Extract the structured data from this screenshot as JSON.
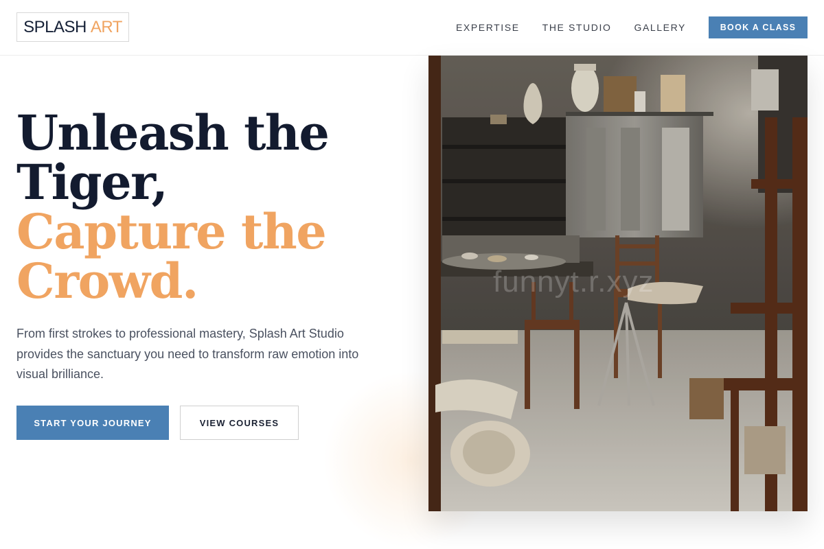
{
  "header": {
    "logo_brand": "SPLASH",
    "logo_accent": "ART",
    "nav": [
      "EXPERTISE",
      "THE STUDIO",
      "GALLERY"
    ],
    "cta_label": "BOOK A CLASS"
  },
  "hero": {
    "title_line1": "Unleash the",
    "title_line2": "Tiger,",
    "title_line3": "Capture the",
    "title_line4": "Crowd.",
    "subtitle": "From first strokes to professional mastery, Splash Art Studio provides the sanctuary you need to transform raw emotion into visual brilliance.",
    "primary_button": "START YOUR JOURNEY",
    "secondary_button": "VIEW COURSES",
    "image_alt": "Cluttered art studio with wooden chairs and shelves of pottery",
    "watermark": "funnyt.r.xyz"
  },
  "colors": {
    "accent_orange": "#f0a461",
    "accent_blue": "#4a80b4",
    "heading_dark": "#131b2f"
  }
}
